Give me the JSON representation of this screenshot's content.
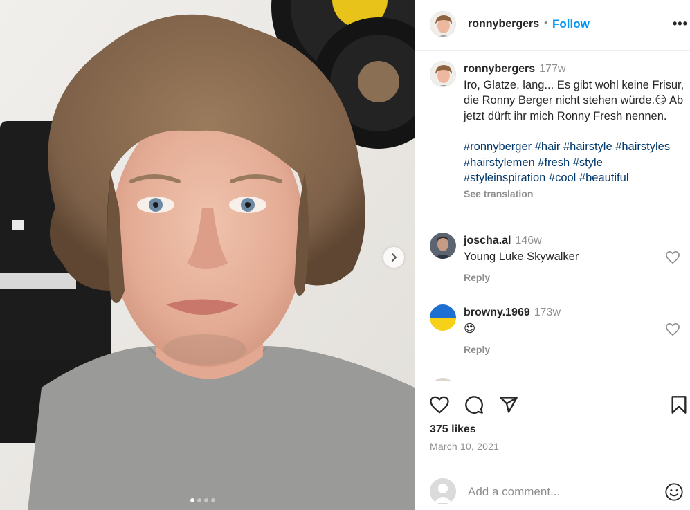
{
  "post": {
    "username": "ronnybergers",
    "follow_label": "Follow",
    "separator": "•",
    "more_label": "•••"
  },
  "caption": {
    "username": "ronnybergers",
    "time": "177w",
    "text": "Iro, Glatze, lang... Es gibt wohl keine Frisur, die Ronny Berger nicht stehen würde.😏 Ab jetzt dürft ihr mich Ronny Fresh nennen.",
    "hashtags": "#ronnyberger #hair #hairstyle #hairstyles #hairstylemen #fresh #style #styleinspiration #cool #beautiful",
    "see_translation": "See translation"
  },
  "comments": [
    {
      "username": "joscha.al",
      "time": "146w",
      "text": "Young Luke Skywalker",
      "reply": "Reply"
    },
    {
      "username": "browny.1969",
      "time": "173w",
      "text": "😍",
      "reply": "Reply"
    }
  ],
  "stats": {
    "likes": "375 likes",
    "date": "March 10, 2021"
  },
  "composer": {
    "placeholder": "Add a comment..."
  },
  "carousel": {
    "slide_count": 4,
    "active_index": 0
  },
  "icons": {
    "like": "heart-icon",
    "comment": "comment-bubble-icon",
    "share": "paper-plane-icon",
    "save": "bookmark-icon",
    "next": "chevron-right-icon",
    "emoji": "smiley-icon"
  },
  "colors": {
    "follow": "#0095f6",
    "hashtag": "#00376b",
    "muted": "#8e8e8e",
    "text": "#262626"
  }
}
